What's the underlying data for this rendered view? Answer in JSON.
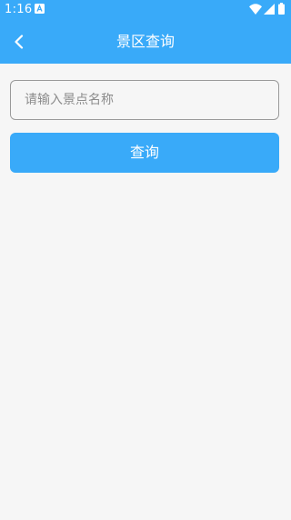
{
  "status_bar": {
    "time": "1:16",
    "notification_icon": "a-notification-icon",
    "wifi_icon": "wifi-icon",
    "signal_icon": "cell-signal-icon",
    "battery_icon": "battery-icon"
  },
  "header": {
    "title": "景区查询",
    "back_icon": "chevron-left-icon",
    "background_color": "#39aaf9"
  },
  "search": {
    "value": "",
    "placeholder": "请输入景点名称"
  },
  "query_button": {
    "label": "查询",
    "color": "#39aaf9"
  },
  "page": {
    "background_color": "#f6f6f6"
  }
}
